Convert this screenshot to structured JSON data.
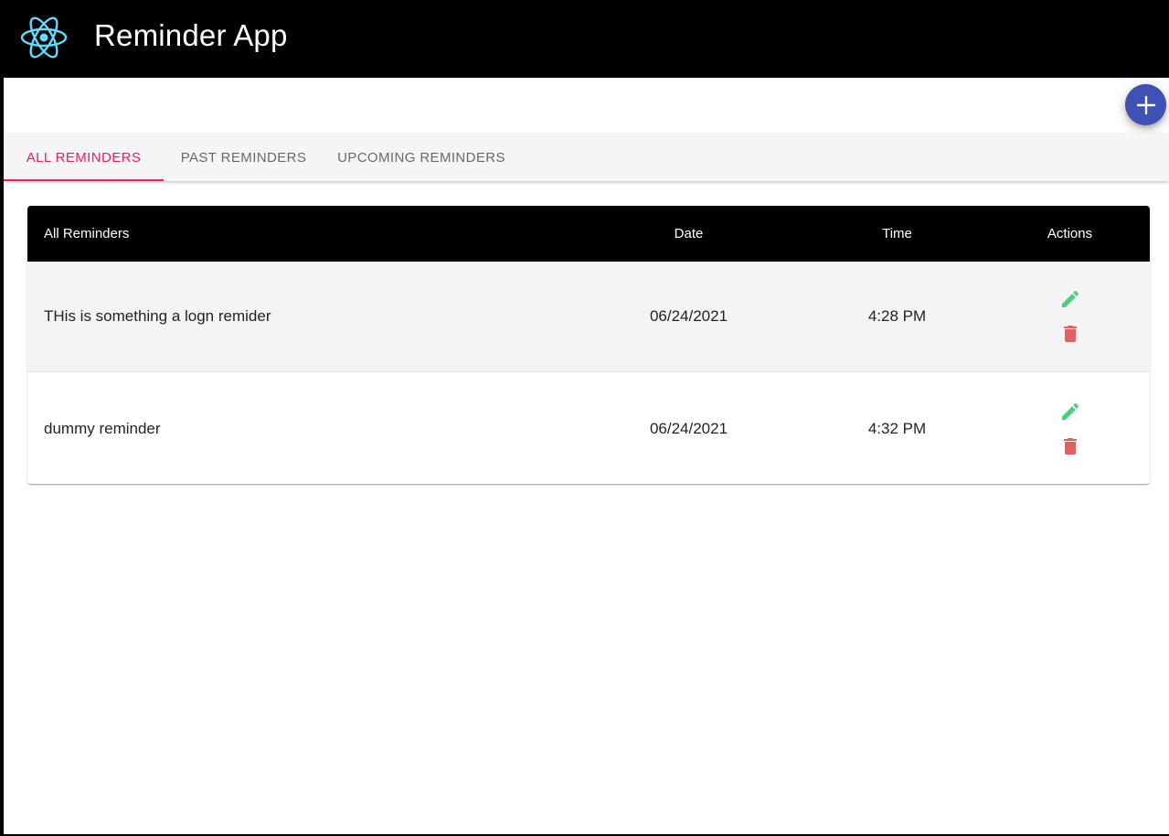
{
  "app": {
    "title": "Reminder App",
    "logo_icon": "react-atom-icon",
    "logo_color": "#61dafb"
  },
  "fab": {
    "icon": "plus-icon",
    "color": "#3f51b5"
  },
  "tabs": [
    {
      "label": "ALL REMINDERS",
      "active": true
    },
    {
      "label": "PAST REMINDERS",
      "active": false
    },
    {
      "label": "UPCOMING REMINDERS",
      "active": false
    }
  ],
  "table": {
    "headers": {
      "name": "All Reminders",
      "date": "Date",
      "time": "Time",
      "actions": "Actions"
    },
    "rows": [
      {
        "name": "THis is something a logn remider",
        "date": "06/24/2021",
        "time": "4:28 PM"
      },
      {
        "name": "dummy reminder",
        "date": "06/24/2021",
        "time": "4:32 PM"
      }
    ],
    "edit_icon": "pencil-icon",
    "edit_color": "#4cd080",
    "delete_icon": "trash-icon",
    "delete_color": "#e06060"
  },
  "accent": "#e91e63"
}
